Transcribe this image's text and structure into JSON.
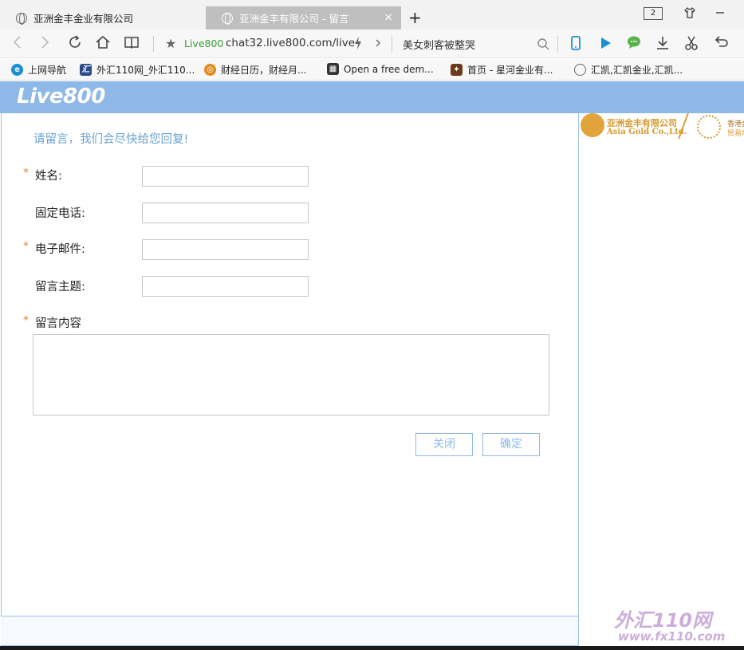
{
  "tabs": [
    {
      "title": "亚洲金丰金业有限公司",
      "active": false
    },
    {
      "title": "亚洲金丰有限公司 - 留言",
      "active": true
    }
  ],
  "tab_close": "×",
  "new_tab": "+",
  "tab_count": "2",
  "nav": {
    "url_label": "Live800",
    "url": "chat32.live800.com/live",
    "search_text": "美女刺客被整哭"
  },
  "bookmarks": [
    {
      "label": "上网导航"
    },
    {
      "label": "外汇110网_外汇110..."
    },
    {
      "label": "财经日历，财经月..."
    },
    {
      "label": "Open a free dem..."
    },
    {
      "label": "首页 - 星河金业有..."
    },
    {
      "label": "汇凯,汇凯金业,汇凯..."
    }
  ],
  "page": {
    "logo": "Live800",
    "prompt": "请留言，我们会尽快给您回复!",
    "required_mark": "*",
    "fields": [
      {
        "label": "姓名:",
        "required": true,
        "value": ""
      },
      {
        "label": "固定电话:",
        "required": false,
        "value": ""
      },
      {
        "label": "电子邮件:",
        "required": true,
        "value": ""
      },
      {
        "label": "留言主题:",
        "required": false,
        "value": ""
      }
    ],
    "content_label": "留言内容",
    "content_value": "",
    "close_button": "关闭",
    "confirm_button": "确定"
  },
  "brand": {
    "name_cn": "亚洲金丰有限公司",
    "name_en": "Asia Gold Co.,Ltd.",
    "hk_line1": "香港金",
    "hk_line2": "贸易场"
  },
  "watermark": {
    "line1": "外汇110网",
    "line2": "www.fx110.com"
  },
  "colors": {
    "accent": "#8db8e7",
    "brand_gold": "#d99a2b",
    "required": "#e08830"
  }
}
